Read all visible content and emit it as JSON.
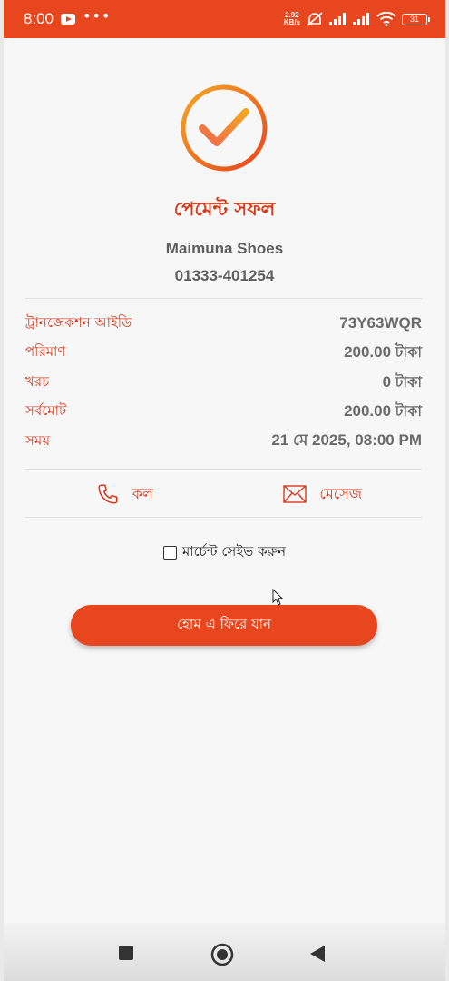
{
  "status_bar": {
    "time": "8:00",
    "dots": "•••",
    "speed_value": "2.92",
    "speed_unit": "KB/s",
    "battery": "31",
    "icons": [
      "youtube-icon",
      "alarm-off-icon",
      "signal-icon",
      "signal-icon",
      "wifi-icon",
      "battery-icon"
    ]
  },
  "receipt": {
    "title": "পেমেন্ট সফল",
    "merchant_name": "Maimuna Shoes",
    "merchant_phone": "01333-401254",
    "rows": [
      {
        "label": "ট্রানজেকশন আইডি",
        "value": "73Y63WQR",
        "unit": ""
      },
      {
        "label": "পরিমাণ",
        "value": "200.00",
        "unit": "টাকা"
      },
      {
        "label": "খরচ",
        "value": "0",
        "unit": "টাকা"
      },
      {
        "label": "সর্বমোট",
        "value": "200.00",
        "unit": "টাকা"
      },
      {
        "label": "সময়",
        "value": "21 মে 2025, 08:00 PM",
        "unit": ""
      }
    ]
  },
  "actions": {
    "call_label": "কল",
    "message_label": "মেসেজ"
  },
  "save_merchant": {
    "label": "মার্চেন্ট সেইভ করুন",
    "checked": false
  },
  "home_button": {
    "label": "হোম এ ফিরে যান"
  },
  "colors": {
    "accent": "#e8461e",
    "label_red": "#d63a1c",
    "check_gradient_start": "#f5a623",
    "check_gradient_end": "#e8461e"
  },
  "nav_bar": {
    "icons": [
      "recents-square-icon",
      "home-circle-icon",
      "back-triangle-icon"
    ]
  }
}
